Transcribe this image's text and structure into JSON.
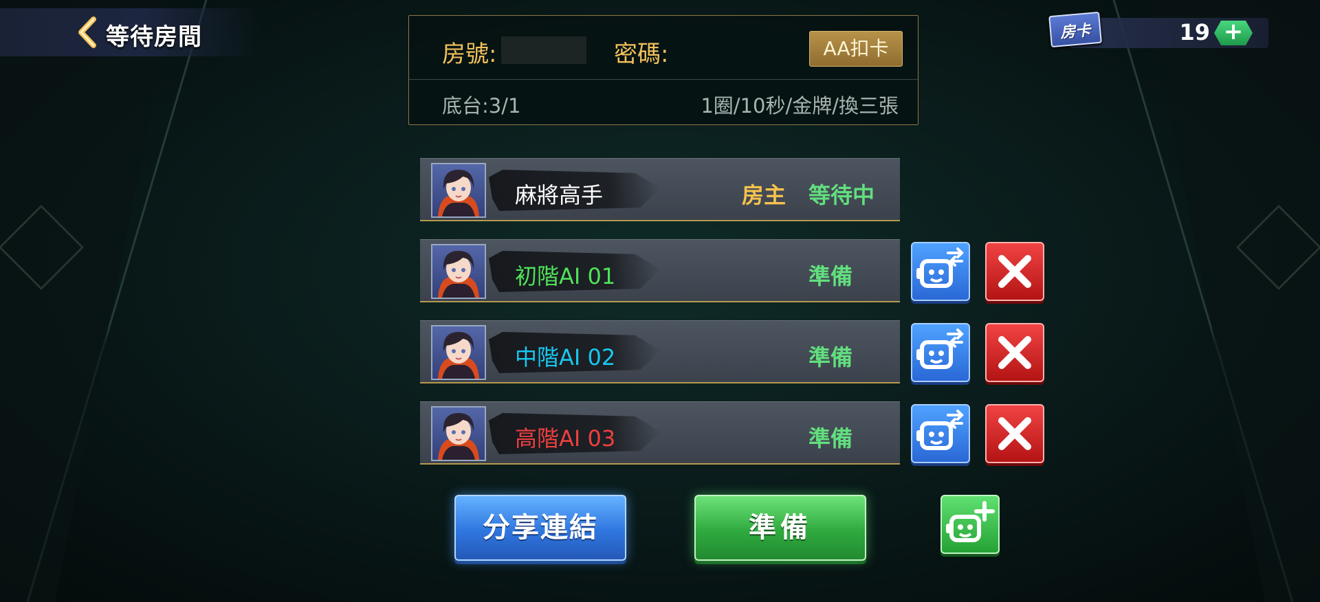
{
  "header": {
    "back_icon": "chevron-left-icon",
    "title": "等待房間"
  },
  "room_card": {
    "icon_label": "房卡",
    "count": "19",
    "add_icon": "plus-icon"
  },
  "room_info": {
    "room_no_label": "房號:",
    "password_label": "密碼:",
    "aa_button": "AA扣卡",
    "base_label": "底台:3/1",
    "rules": "1圈/10秒/金牌/換三張"
  },
  "players": [
    {
      "name": "麻將高手",
      "name_color": "#ffffff",
      "role": "房主",
      "status": "等待中",
      "is_host": true
    },
    {
      "name": "初階AI 01",
      "name_color": "#4fe35a",
      "role": "",
      "status": "準備",
      "is_host": false
    },
    {
      "name": "中階AI 02",
      "name_color": "#18c8f0",
      "role": "",
      "status": "準備",
      "is_host": false
    },
    {
      "name": "高階AI 03",
      "name_color": "#ef4040",
      "role": "",
      "status": "準備",
      "is_host": false
    }
  ],
  "ai_controls": {
    "swap_icon": "robot-swap-icon",
    "kick_icon": "close-icon"
  },
  "bottom": {
    "share_button": "分享連結",
    "ready_button": "準備",
    "add_ai_icon": "robot-add-icon"
  },
  "colors": {
    "gold": "#f3c25b",
    "status_green": "#62df7e",
    "button_blue": "#2f76df",
    "button_green": "#2faa3e",
    "button_red": "#b41414"
  }
}
